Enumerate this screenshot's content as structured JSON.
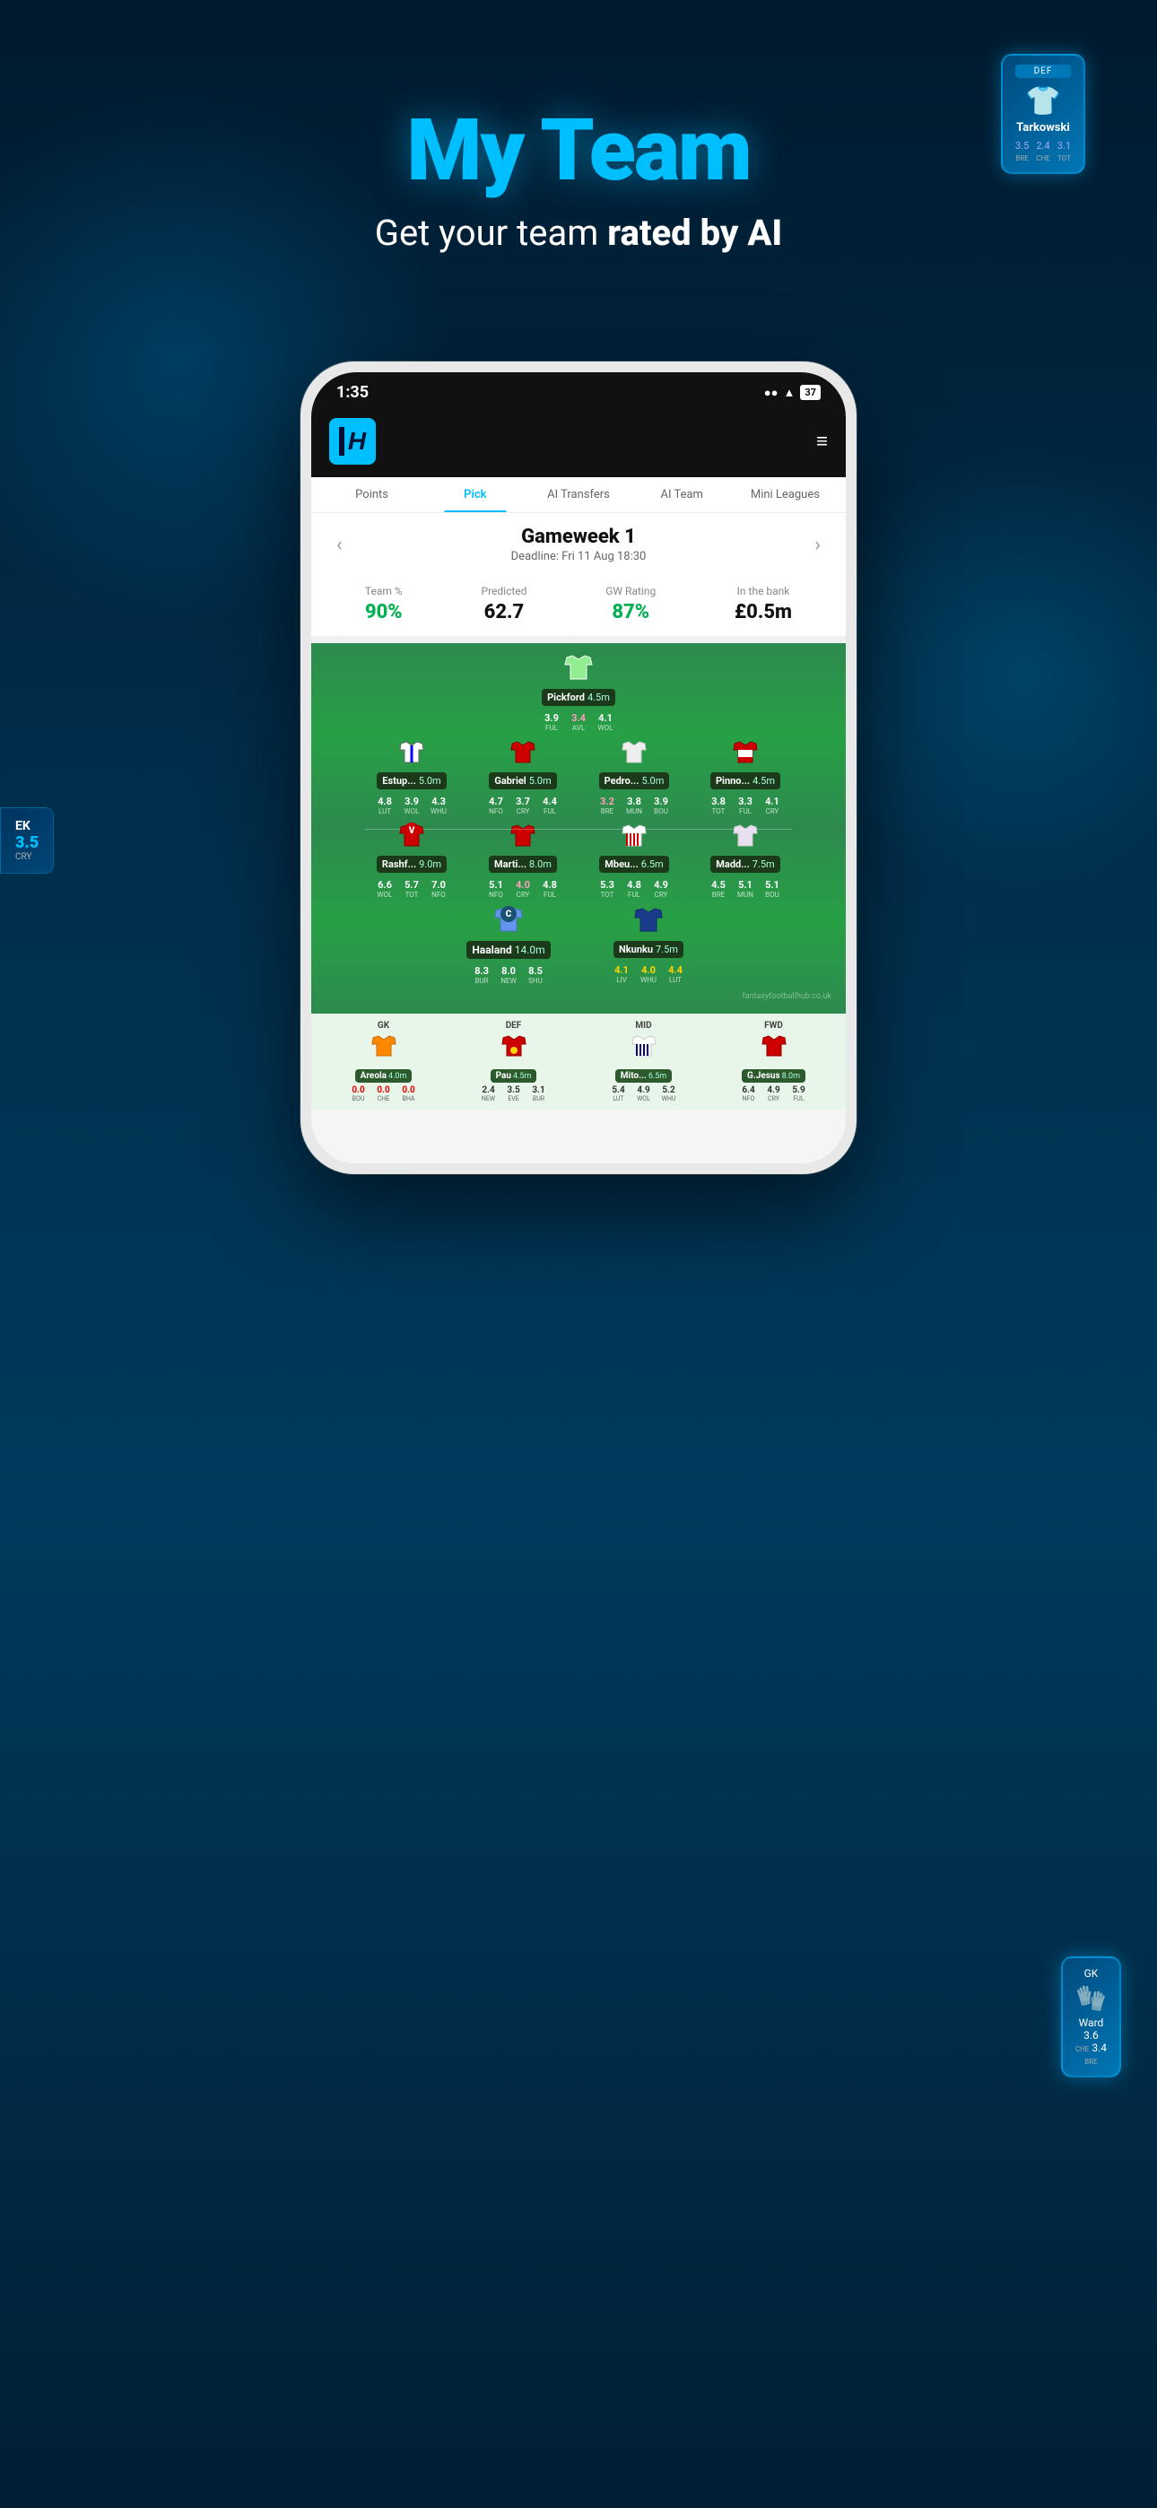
{
  "hero": {
    "title": "My Team",
    "subtitle_plain": "Get your team ",
    "subtitle_bold": "rated by AI"
  },
  "floating_card_top": {
    "position": "DEF",
    "name": "Tarkowski",
    "jersey": "🛡️",
    "stats": [
      {
        "val": "3.5",
        "team": "BRE"
      },
      {
        "val": "2.4",
        "team": "CHE"
      },
      {
        "val": "3.1",
        "team": "TOT"
      }
    ]
  },
  "floating_card_bottom": {
    "position": "GK",
    "name": "Ward",
    "stats": [
      {
        "val": "3.6",
        "team": "CHE"
      },
      {
        "val": "3.4",
        "team": "BRE"
      }
    ]
  },
  "phone": {
    "status_bar": {
      "time": "1:35",
      "signal": "●● ▲",
      "wifi": "WiFi",
      "battery": "37"
    },
    "nav_tabs": [
      {
        "label": "Points",
        "active": false
      },
      {
        "label": "Pick",
        "active": true
      },
      {
        "label": "AI Transfers",
        "active": false
      },
      {
        "label": "AI Team",
        "active": false
      },
      {
        "label": "Mini Leagues",
        "active": false
      }
    ],
    "gameweek": {
      "title": "Gameweek 1",
      "deadline": "Deadline: Fri 11 Aug 18:30"
    },
    "stats": {
      "team_pct_label": "Team %",
      "team_pct_value": "90%",
      "predicted_label": "Predicted",
      "predicted_value": "62.7",
      "gw_rating_label": "GW Rating",
      "gw_rating_value": "87%",
      "in_bank_label": "In the bank",
      "in_bank_value": "£0.5m"
    },
    "pitch": {
      "watermark": "fantasyfootballhub.co.uk",
      "goalkeeper": {
        "name": "Pickford",
        "price": "4.5m",
        "jersey": "GK",
        "scores": [
          {
            "val": "3.9",
            "team": "FUL"
          },
          {
            "val": "3.4",
            "team": "AVL",
            "pink": true
          },
          {
            "val": "4.1",
            "team": "WOL"
          }
        ]
      },
      "defenders": [
        {
          "name": "Estup...",
          "price": "5.0m",
          "jersey": "DEF_STRIPE",
          "scores": [
            {
              "val": "4.8",
              "team": "LUT"
            },
            {
              "val": "3.9",
              "team": "WOL"
            },
            {
              "val": "4.3",
              "team": "WHU"
            }
          ]
        },
        {
          "name": "Gabriel",
          "price": "5.0m",
          "jersey": "DEF_RED",
          "scores": [
            {
              "val": "4.7",
              "team": "NFO"
            },
            {
              "val": "3.7",
              "team": "CRY"
            },
            {
              "val": "4.4",
              "team": "FUL"
            }
          ]
        },
        {
          "name": "Pedro...",
          "price": "5.0m",
          "jersey": "DEF_WHITE",
          "scores": [
            {
              "val": "3.2",
              "team": "BRE",
              "pink": true
            },
            {
              "val": "3.8",
              "team": "MUN"
            },
            {
              "val": "3.9",
              "team": "BOU"
            }
          ]
        },
        {
          "name": "Pinno...",
          "price": "4.5m",
          "jersey": "DEF_RED2",
          "scores": [
            {
              "val": "3.8",
              "team": "TOT"
            },
            {
              "val": "3.3",
              "team": "FUL"
            },
            {
              "val": "4.1",
              "team": "CRY"
            }
          ]
        }
      ],
      "midfielders": [
        {
          "name": "Rashf...",
          "price": "9.0m",
          "jersey": "MID_RED",
          "badge": "V",
          "scores": [
            {
              "val": "6.6",
              "team": "WOL"
            },
            {
              "val": "5.7",
              "team": "TOT"
            },
            {
              "val": "7.0",
              "team": "NFO"
            }
          ]
        },
        {
          "name": "Marti...",
          "price": "8.0m",
          "jersey": "MID_RED2",
          "scores": [
            {
              "val": "5.1",
              "team": "NFO"
            },
            {
              "val": "4.0",
              "team": "CRY",
              "pink": true
            },
            {
              "val": "4.8",
              "team": "FUL"
            }
          ]
        },
        {
          "name": "Mbeu...",
          "price": "6.5m",
          "jersey": "MID_STRIPE",
          "scores": [
            {
              "val": "5.3",
              "team": "TOT"
            },
            {
              "val": "4.8",
              "team": "FUL"
            },
            {
              "val": "4.9",
              "team": "CRY"
            }
          ]
        },
        {
          "name": "Madd...",
          "price": "7.5m",
          "jersey": "MID_WHITE",
          "scores": [
            {
              "val": "4.5",
              "team": "BRE"
            },
            {
              "val": "5.1",
              "team": "MUN"
            },
            {
              "val": "5.1",
              "team": "BOU"
            }
          ]
        }
      ],
      "forwards": [
        {
          "name": "Haaland",
          "price": "14.0m",
          "jersey": "FWD_BLUE",
          "badge": "C",
          "scores": [
            {
              "val": "8.3",
              "team": "BUR"
            },
            {
              "val": "8.0",
              "team": "NEW"
            },
            {
              "val": "8.5",
              "team": "SHU"
            }
          ]
        },
        {
          "name": "Nkunku",
          "price": "7.5m",
          "jersey": "FWD_BLUE2",
          "scores": [
            {
              "val": "4.1",
              "team": "LIV"
            },
            {
              "val": "4.0",
              "team": "WHU"
            },
            {
              "val": "4.4",
              "team": "LUT"
            }
          ]
        }
      ]
    },
    "bench": [
      {
        "position": "GK",
        "name": "Areola",
        "price": "4.0m",
        "jersey": "GK_BENCH",
        "scores": [
          {
            "val": "0.0",
            "team": "BOU",
            "red": true
          },
          {
            "val": "0.0",
            "team": "CHE",
            "red": true
          },
          {
            "val": "0.0",
            "team": "BHA",
            "red": true
          }
        ]
      },
      {
        "position": "DEF",
        "name": "Pau",
        "price": "4.5m",
        "jersey": "DEF_BENCH",
        "scores": [
          {
            "val": "2.4",
            "team": "NEW"
          },
          {
            "val": "3.5",
            "team": "EVE"
          },
          {
            "val": "3.1",
            "team": "BUR"
          }
        ]
      },
      {
        "position": "MID",
        "name": "Mito...",
        "price": "6.5m",
        "jersey": "MID_BENCH",
        "scores": [
          {
            "val": "5.4",
            "team": "LUT"
          },
          {
            "val": "4.9",
            "team": "WOL"
          },
          {
            "val": "5.2",
            "team": "WHU"
          }
        ]
      },
      {
        "position": "FWD",
        "name": "G.Jesus",
        "price": "8.0m",
        "jersey": "FWD_BENCH",
        "scores": [
          {
            "val": "6.4",
            "team": "NFO"
          },
          {
            "val": "4.9",
            "team": "CRY"
          },
          {
            "val": "5.9",
            "team": "FUL"
          }
        ]
      }
    ]
  },
  "side_teaser": {
    "line1": "EK",
    "line2": "3.5",
    "line3": "CRY"
  }
}
